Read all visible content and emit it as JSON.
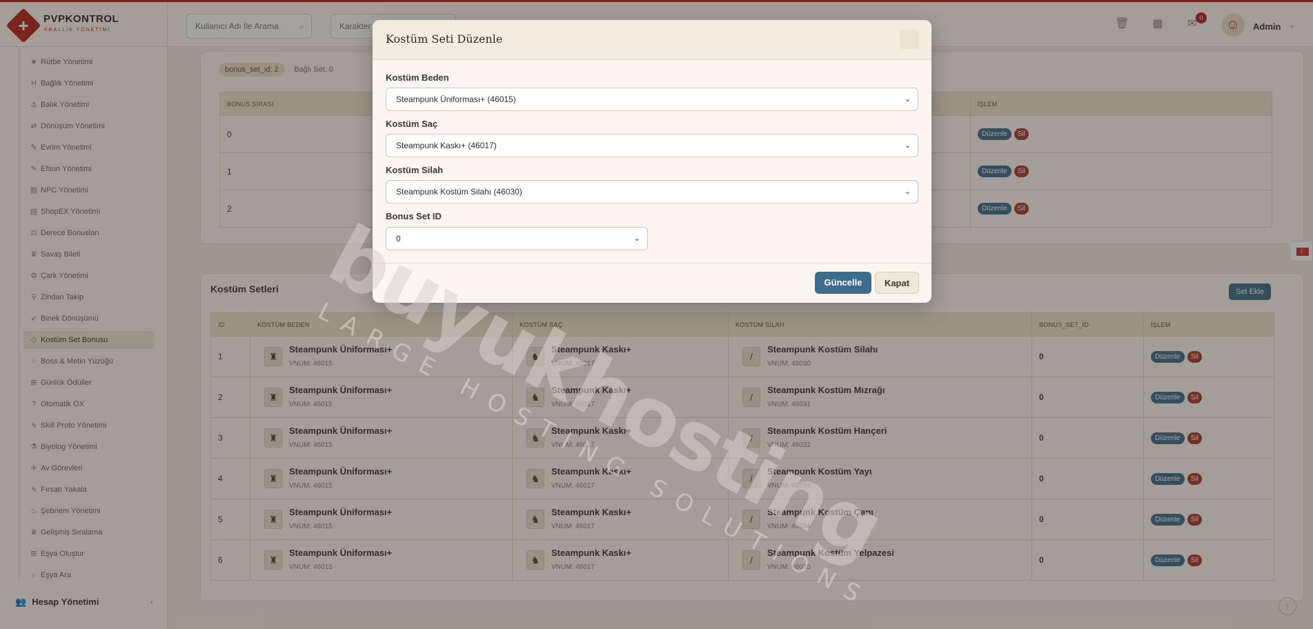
{
  "brand": {
    "name": "PVPKONTROL",
    "subtitle": "KRALLIK YÖNETİMİ"
  },
  "topbar": {
    "search_user_placeholder": "Kullanıcı Adı İle Arama",
    "search_char_placeholder": "Karakter",
    "notification_count": "0",
    "user_name": "Admin"
  },
  "sidebar": {
    "items": [
      {
        "label": "Rütbe Yönetimi",
        "icon": "star-icon"
      },
      {
        "label": "Bağlık Yönetimi",
        "icon": "h-icon"
      },
      {
        "label": "Balık Yönetimi",
        "icon": "anchor-icon"
      },
      {
        "label": "Dönüşüm Yönetimi",
        "icon": "shuffle-icon"
      },
      {
        "label": "Evrim Yönetimi",
        "icon": "wand-icon"
      },
      {
        "label": "Efsun Yönetimi",
        "icon": "wand-icon"
      },
      {
        "label": "NPC Yönetimi",
        "icon": "building-icon"
      },
      {
        "label": "ShopEX Yönetimi",
        "icon": "shop-icon"
      },
      {
        "label": "Derece Bonusları",
        "icon": "scale-icon"
      },
      {
        "label": "Savaş Bileti",
        "icon": "trophy-icon"
      },
      {
        "label": "Çark Yönetimi",
        "icon": "wheel-icon"
      },
      {
        "label": "Zindan Takip",
        "icon": "pin-icon"
      },
      {
        "label": "Binek Dönüşümü",
        "icon": "rocket-icon"
      },
      {
        "label": "Kostüm Set Bonusu",
        "icon": "gem-icon"
      },
      {
        "label": "Boss & Metin Yüzüğü",
        "icon": "ring-icon"
      },
      {
        "label": "Günlük Ödüller",
        "icon": "gift-icon"
      },
      {
        "label": "Otomatik OX",
        "icon": "question-icon"
      },
      {
        "label": "Skill Proto Yönetimi",
        "icon": "bolt-icon"
      },
      {
        "label": "Biyolog Yönetimi",
        "icon": "flask-icon"
      },
      {
        "label": "Av Görevleri",
        "icon": "crosshair-icon"
      },
      {
        "label": "Fırsatı Yakala",
        "icon": "bolt-icon"
      },
      {
        "label": "Şebnem Yönetimi",
        "icon": "flame-icon"
      },
      {
        "label": "Gelişmiş Sıralama",
        "icon": "trophy-icon"
      },
      {
        "label": "Eşya Oluştur",
        "icon": "gift-icon"
      },
      {
        "label": "Eşya Ara",
        "icon": "search-icon"
      }
    ],
    "active_index": 13,
    "footer_label": "Hesap Yönetimi"
  },
  "bonus_panel": {
    "chip_id": "bonus_set_id: 2",
    "chip_count": "Bağlı Set: 0",
    "headers": [
      "BONUS SIRASI",
      "İŞLEM"
    ],
    "rows": [
      "0",
      "1",
      "2"
    ],
    "edit_label": "Düzenle",
    "delete_label": "Sil"
  },
  "sets_panel": {
    "title": "Kostüm Setleri",
    "add_button": "Set Ekle",
    "headers": [
      "ID",
      "KOSTÜM BEDEN",
      "KOSTÜM SAÇ",
      "KOSTÜM SİLAH",
      "BONUS_SET_İD",
      "İŞLEM"
    ],
    "edit_label": "Düzenle",
    "delete_label": "Sil",
    "rows": [
      {
        "id": "1",
        "body": "Steampunk Üniforması+",
        "body_vnum": "VNUM: 46015",
        "hair": "Steampunk Kaskı+",
        "hair_vnum": "VNUM: 46017",
        "weapon": "Steampunk Kostüm Silahı",
        "weapon_vnum": "VNUM: 46030",
        "bonus": "0"
      },
      {
        "id": "2",
        "body": "Steampunk Üniforması+",
        "body_vnum": "VNUM: 46015",
        "hair": "Steampunk Kaskı+",
        "hair_vnum": "VNUM: 46017",
        "weapon": "Steampunk Kostüm Mızrağı",
        "weapon_vnum": "VNUM: 46031",
        "bonus": "0"
      },
      {
        "id": "3",
        "body": "Steampunk Üniforması+",
        "body_vnum": "VNUM: 46015",
        "hair": "Steampunk Kaskı+",
        "hair_vnum": "VNUM: 46017",
        "weapon": "Steampunk Kostüm Hançeri",
        "weapon_vnum": "VNUM: 46032",
        "bonus": "0"
      },
      {
        "id": "4",
        "body": "Steampunk Üniforması+",
        "body_vnum": "VNUM: 46015",
        "hair": "Steampunk Kaskı+",
        "hair_vnum": "VNUM: 46017",
        "weapon": "Steampunk Kostüm Yayı",
        "weapon_vnum": "VNUM: 46033",
        "bonus": "0"
      },
      {
        "id": "5",
        "body": "Steampunk Üniforması+",
        "body_vnum": "VNUM: 46015",
        "hair": "Steampunk Kaskı+",
        "hair_vnum": "VNUM: 46017",
        "weapon": "Steampunk Kostüm Çanı",
        "weapon_vnum": "VNUM: 46034",
        "bonus": "0"
      },
      {
        "id": "6",
        "body": "Steampunk Üniforması+",
        "body_vnum": "VNUM: 46015",
        "hair": "Steampunk Kaskı+",
        "hair_vnum": "VNUM: 46017",
        "weapon": "Steampunk Kostüm Yelpazesi",
        "weapon_vnum": "VNUM: 46035",
        "bonus": "0"
      }
    ]
  },
  "modal": {
    "title": "Kostüm Seti Düzenle",
    "fields": [
      {
        "label": "Kostüm Beden",
        "value": "Steampunk Üniforması+ (46015)"
      },
      {
        "label": "Kostüm Saç",
        "value": "Steampunk Kaskı+ (46017)"
      },
      {
        "label": "Kostüm Silah",
        "value": "Steampunk Kostüm Silahı (46030)"
      },
      {
        "label": "Bonus Set ID",
        "value": "0"
      }
    ],
    "submit_label": "Güncelle",
    "close_label": "Kapat"
  },
  "watermark": {
    "main": "buyukhosting",
    "sub": "LARGE HOSTING SOLUTIONS"
  },
  "colors": {
    "accent": "#3d6d8a",
    "danger": "#a83a2e",
    "brand": "#b3261e"
  }
}
